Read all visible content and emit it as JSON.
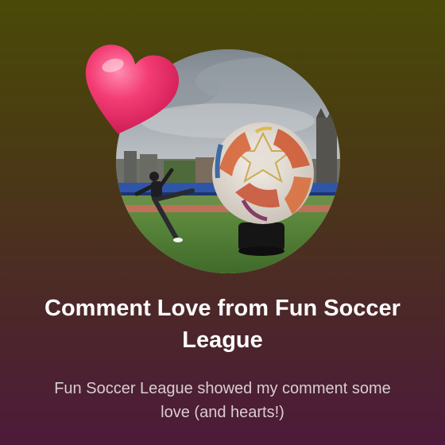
{
  "card": {
    "title": "Comment Love from Fun Soccer League",
    "description": "Fun Soccer League showed my comment some love (and hearts!)"
  },
  "icons": {
    "reaction": "heart-icon"
  },
  "colors": {
    "gradient_top": "#4a4a08",
    "gradient_bottom": "#4d1a3a",
    "heart": "#f0346e",
    "title_text": "#ffffff",
    "description_text": "#d9cdd2"
  }
}
